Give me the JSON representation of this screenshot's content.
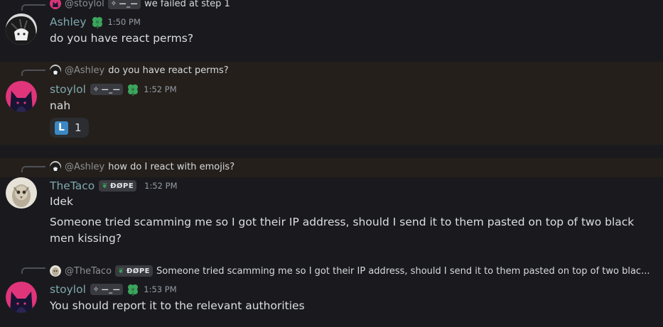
{
  "messages": [
    {
      "id": "m1",
      "reply": {
        "name": "@stoylol",
        "tag": "—_—",
        "text": "we failed at step 1"
      },
      "author": "Ashley",
      "time": "1:50 PM",
      "lines": [
        "do you have react perms?"
      ]
    },
    {
      "id": "m2",
      "reply": {
        "name": "@Ashley",
        "text": "do you have react perms?"
      },
      "author": "stoylol",
      "tag": "—_—",
      "time": "1:52 PM",
      "lines": [
        "nah"
      ],
      "reaction": {
        "emoji": "L",
        "count": "1"
      }
    },
    {
      "id": "m3",
      "reply": {
        "name": "@Ashley",
        "text": "how do I react with emojis?"
      },
      "author": "TheTaco",
      "tag": "ĐØPE",
      "time": "1:52 PM",
      "lines": [
        "Idek",
        "Someone tried scamming me so I got their IP address, should I send it to them pasted on top of two black men kissing?"
      ]
    },
    {
      "id": "m4",
      "reply": {
        "name": "@TheTaco",
        "tag": "ĐØPE",
        "text": "Someone tried scamming me so I got their IP address, should I send it to them pasted on top of two blac..."
      },
      "author": "stoylol",
      "tag": "—_—",
      "time": "1:53 PM",
      "lines": [
        "You should report it to the relevant authorities"
      ]
    }
  ],
  "colors": {
    "background": "#1a1a1e",
    "highlight": "#241f1b",
    "username": "#7fa8ad",
    "timestamp": "#949ba4",
    "reaction_bg": "#2b2d31",
    "clover": "#3ba55c"
  },
  "icons": [
    "clover-icon",
    "star-icon",
    "leaf-icon",
    "regional-indicator-l-icon"
  ]
}
